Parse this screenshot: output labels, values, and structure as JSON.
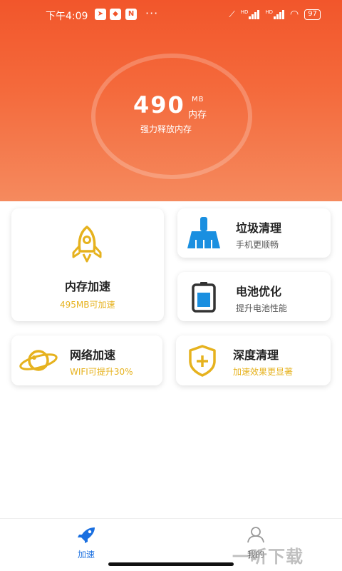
{
  "status": {
    "time": "下午4:09",
    "icons": [
      "location-icon",
      "vpn-icon",
      "n-icon"
    ],
    "dots": "···",
    "battery": "97",
    "hd1": "HD",
    "hd2": "HD"
  },
  "memory": {
    "value": "490",
    "unit": "MB",
    "unit_label": "内存",
    "subtitle": "强力释放内存"
  },
  "cards": {
    "memory_boost": {
      "title": "内存加速",
      "subtitle": "495MB可加速"
    },
    "junk_clean": {
      "title": "垃圾清理",
      "subtitle": "手机更顺畅"
    },
    "battery_opt": {
      "title": "电池优化",
      "subtitle": "提升电池性能"
    },
    "network_boost": {
      "title": "网络加速",
      "subtitle": "WIFI可提升30%"
    },
    "deep_clean": {
      "title": "深度清理",
      "subtitle": "加速效果更显著"
    }
  },
  "tabs": [
    {
      "label": "加速",
      "active": true
    },
    {
      "label": "我的",
      "active": false
    }
  ],
  "watermark": "一听下载",
  "colors": {
    "hero_top": "#f2562b",
    "hero_bottom": "#f58a5e",
    "accent_yellow": "#e6b21e",
    "icon_blue": "#1a8fe0",
    "tab_active": "#1a6fe0"
  }
}
